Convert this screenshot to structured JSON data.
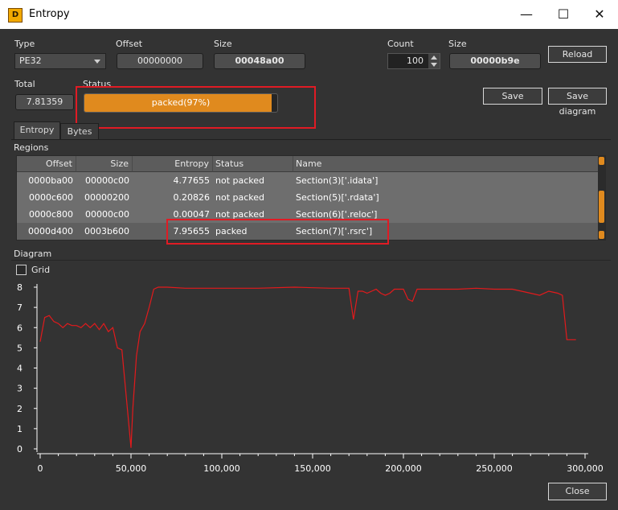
{
  "window": {
    "title": "Entropy",
    "minimize": "—",
    "maximize": "☐",
    "close": "✕"
  },
  "fields": {
    "type_label": "Type",
    "type_value": "PE32",
    "offset_label": "Offset",
    "offset_value": "00000000",
    "size_label": "Size",
    "size_value": "00048a00",
    "count_label": "Count",
    "count_value": "100",
    "size2_label": "Size",
    "size2_value": "00000b9e",
    "total_label": "Total",
    "total_value": "7.81359",
    "status_label": "Status",
    "status_value": "packed(97%)",
    "status_progress": 0.97
  },
  "buttons": {
    "reload": "Reload",
    "save": "Save",
    "save_diagram": "Save diagram",
    "close": "Close"
  },
  "tabs": [
    "Entropy",
    "Bytes"
  ],
  "regions": {
    "label": "Regions",
    "columns": [
      "Offset",
      "Size",
      "Entropy",
      "Status",
      "Name"
    ],
    "rows": [
      [
        "0000ba00",
        "00000c00",
        "4.77655",
        "not packed",
        "Section(3)['.idata']"
      ],
      [
        "0000c600",
        "00000200",
        "0.20826",
        "not packed",
        "Section(5)['.rdata']"
      ],
      [
        "0000c800",
        "00000c00",
        "0.00047",
        "not packed",
        "Section(6)['.reloc']"
      ],
      [
        "0000d400",
        "0003b600",
        "7.95655",
        "packed",
        "Section(7)['.rsrc']"
      ]
    ],
    "selected_row": 3
  },
  "diagram": {
    "label": "Diagram",
    "grid_label": "Grid"
  },
  "colors": {
    "accent": "#e08a1e",
    "highlight": "#e01b24",
    "line": "#e31a1c"
  },
  "chart_data": {
    "type": "line",
    "xlim": [
      0,
      300000
    ],
    "ylim": [
      0,
      8
    ],
    "grid": false,
    "xticks": [
      "0",
      "50,000",
      "100,000",
      "150,000",
      "200,000",
      "250,000",
      "300,000"
    ],
    "yticks": [
      "0",
      "1",
      "2",
      "3",
      "4",
      "5",
      "6",
      "7",
      "8"
    ],
    "series": [
      {
        "x": [
          0,
          2500,
          5000,
          7500,
          10000,
          12500,
          15000,
          17500,
          20000,
          22500,
          25000,
          27500,
          30000,
          32500,
          35000,
          37500,
          40000,
          42500,
          45000,
          47500,
          50000,
          51000,
          53000,
          55000,
          57500,
          60000,
          62500,
          65000,
          67500,
          70000,
          80000,
          100000,
          120000,
          140000,
          160000,
          170000,
          172500,
          175000,
          177500,
          180000,
          182500,
          185000,
          187500,
          190000,
          192500,
          195000,
          197500,
          200000,
          202500,
          205000,
          207500,
          210000,
          212500,
          215000,
          217500,
          220000,
          230000,
          240000,
          250000,
          260000,
          270000,
          275000,
          280000,
          285000,
          287500,
          290000,
          292500,
          295000
        ],
        "y": [
          5.3,
          6.5,
          6.6,
          6.3,
          6.2,
          6.0,
          6.2,
          6.1,
          6.1,
          6.0,
          6.2,
          6.0,
          6.2,
          5.9,
          6.2,
          5.8,
          6.0,
          5.0,
          4.9,
          2.5,
          0.05,
          2.0,
          4.6,
          5.8,
          6.2,
          7.0,
          7.9,
          8.0,
          8.0,
          8.0,
          7.95,
          7.95,
          7.95,
          8.0,
          7.95,
          7.95,
          6.4,
          7.8,
          7.8,
          7.7,
          7.8,
          7.9,
          7.7,
          7.6,
          7.7,
          7.9,
          7.9,
          7.9,
          7.4,
          7.3,
          7.9,
          7.9,
          7.9,
          7.9,
          7.9,
          7.9,
          7.9,
          7.95,
          7.9,
          7.9,
          7.7,
          7.6,
          7.8,
          7.7,
          7.6,
          5.4,
          5.4,
          5.4
        ]
      }
    ]
  }
}
